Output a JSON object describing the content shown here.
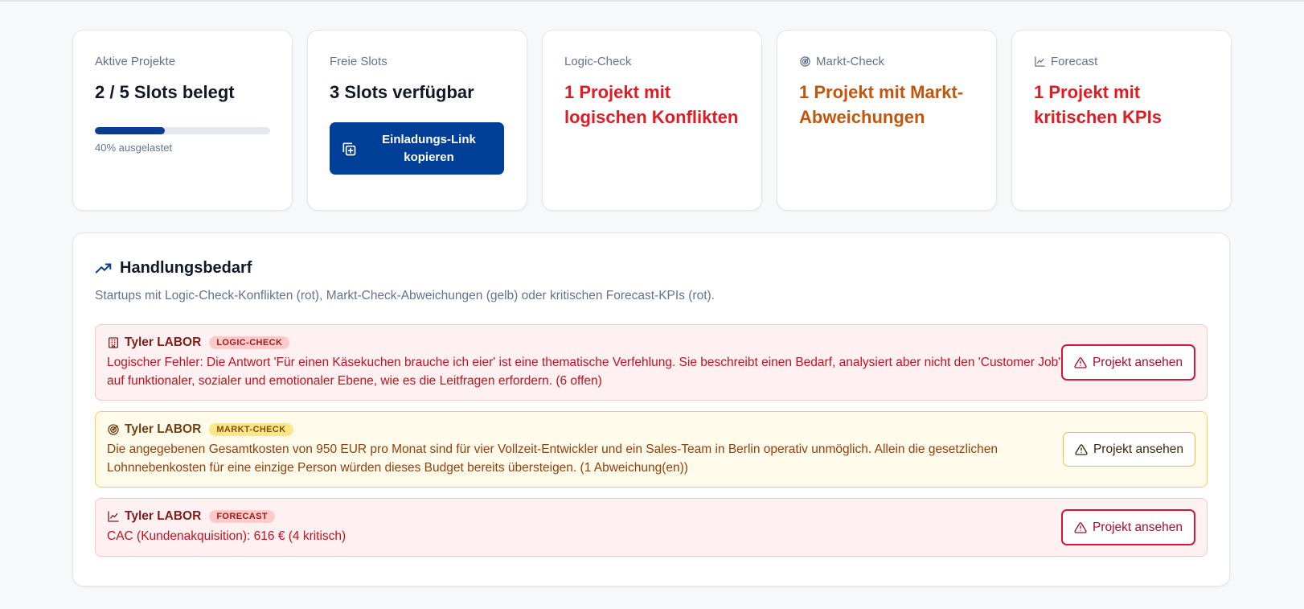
{
  "stats": {
    "active": {
      "label": "Aktive Projekte",
      "value": "2 / 5 Slots belegt",
      "progress_percent": 40,
      "progress_text": "40% ausgelastet"
    },
    "free": {
      "label": "Freie Slots",
      "value": "3 Slots verfügbar",
      "button_label": "Einladungs-Link kopieren"
    },
    "logic": {
      "label": "Logic-Check",
      "value": "1 Projekt mit logischen Konflikten",
      "icon": "none"
    },
    "market": {
      "label": "Markt-Check",
      "value": "1 Projekt mit Markt-Abweichungen",
      "icon": "target-icon"
    },
    "forecast": {
      "label": "Forecast",
      "value": "1 Projekt mit kritischen KPIs",
      "icon": "line-chart-icon"
    }
  },
  "panel": {
    "title": "Handlungsbedarf",
    "description": "Startups mit Logic-Check-Konflikten (rot), Markt-Check-Abweichungen (gelb) oder kritischen Forecast-KPIs (rot).",
    "alerts": [
      {
        "startup": "Tyler LABOR",
        "badge": "LOGIC-CHECK",
        "text": "Logischer Fehler: Die Antwort 'Für einen Käsekuchen brauche ich eier' ist eine thematische Verfehlung. Sie beschreibt einen Bedarf, analysiert aber nicht den 'Customer Job' auf funktionaler, sozialer und emotionaler Ebene, wie es die Leitfragen erfordern. (6 offen)",
        "button": "Projekt ansehen",
        "tone": "red"
      },
      {
        "startup": "Tyler LABOR",
        "badge": "MARKT-CHECK",
        "text": "Die angegebenen Gesamtkosten von 950 EUR pro Monat sind für vier Vollzeit-Entwickler und ein Sales-Team in Berlin operativ unmöglich. Allein die gesetzlichen Lohnnebenkosten für eine einzige Person würden dieses Budget bereits übersteigen. (1 Abweichung(en))",
        "button": "Projekt ansehen",
        "tone": "yellow"
      },
      {
        "startup": "Tyler LABOR",
        "badge": "FORECAST",
        "text": "CAC (Kundenakquisition): 616 € (4 kritisch)",
        "button": "Projekt ansehen",
        "tone": "red"
      }
    ]
  },
  "colors": {
    "primary": "#003f98",
    "danger": "#dc1d24",
    "warning": "#c2560c"
  }
}
